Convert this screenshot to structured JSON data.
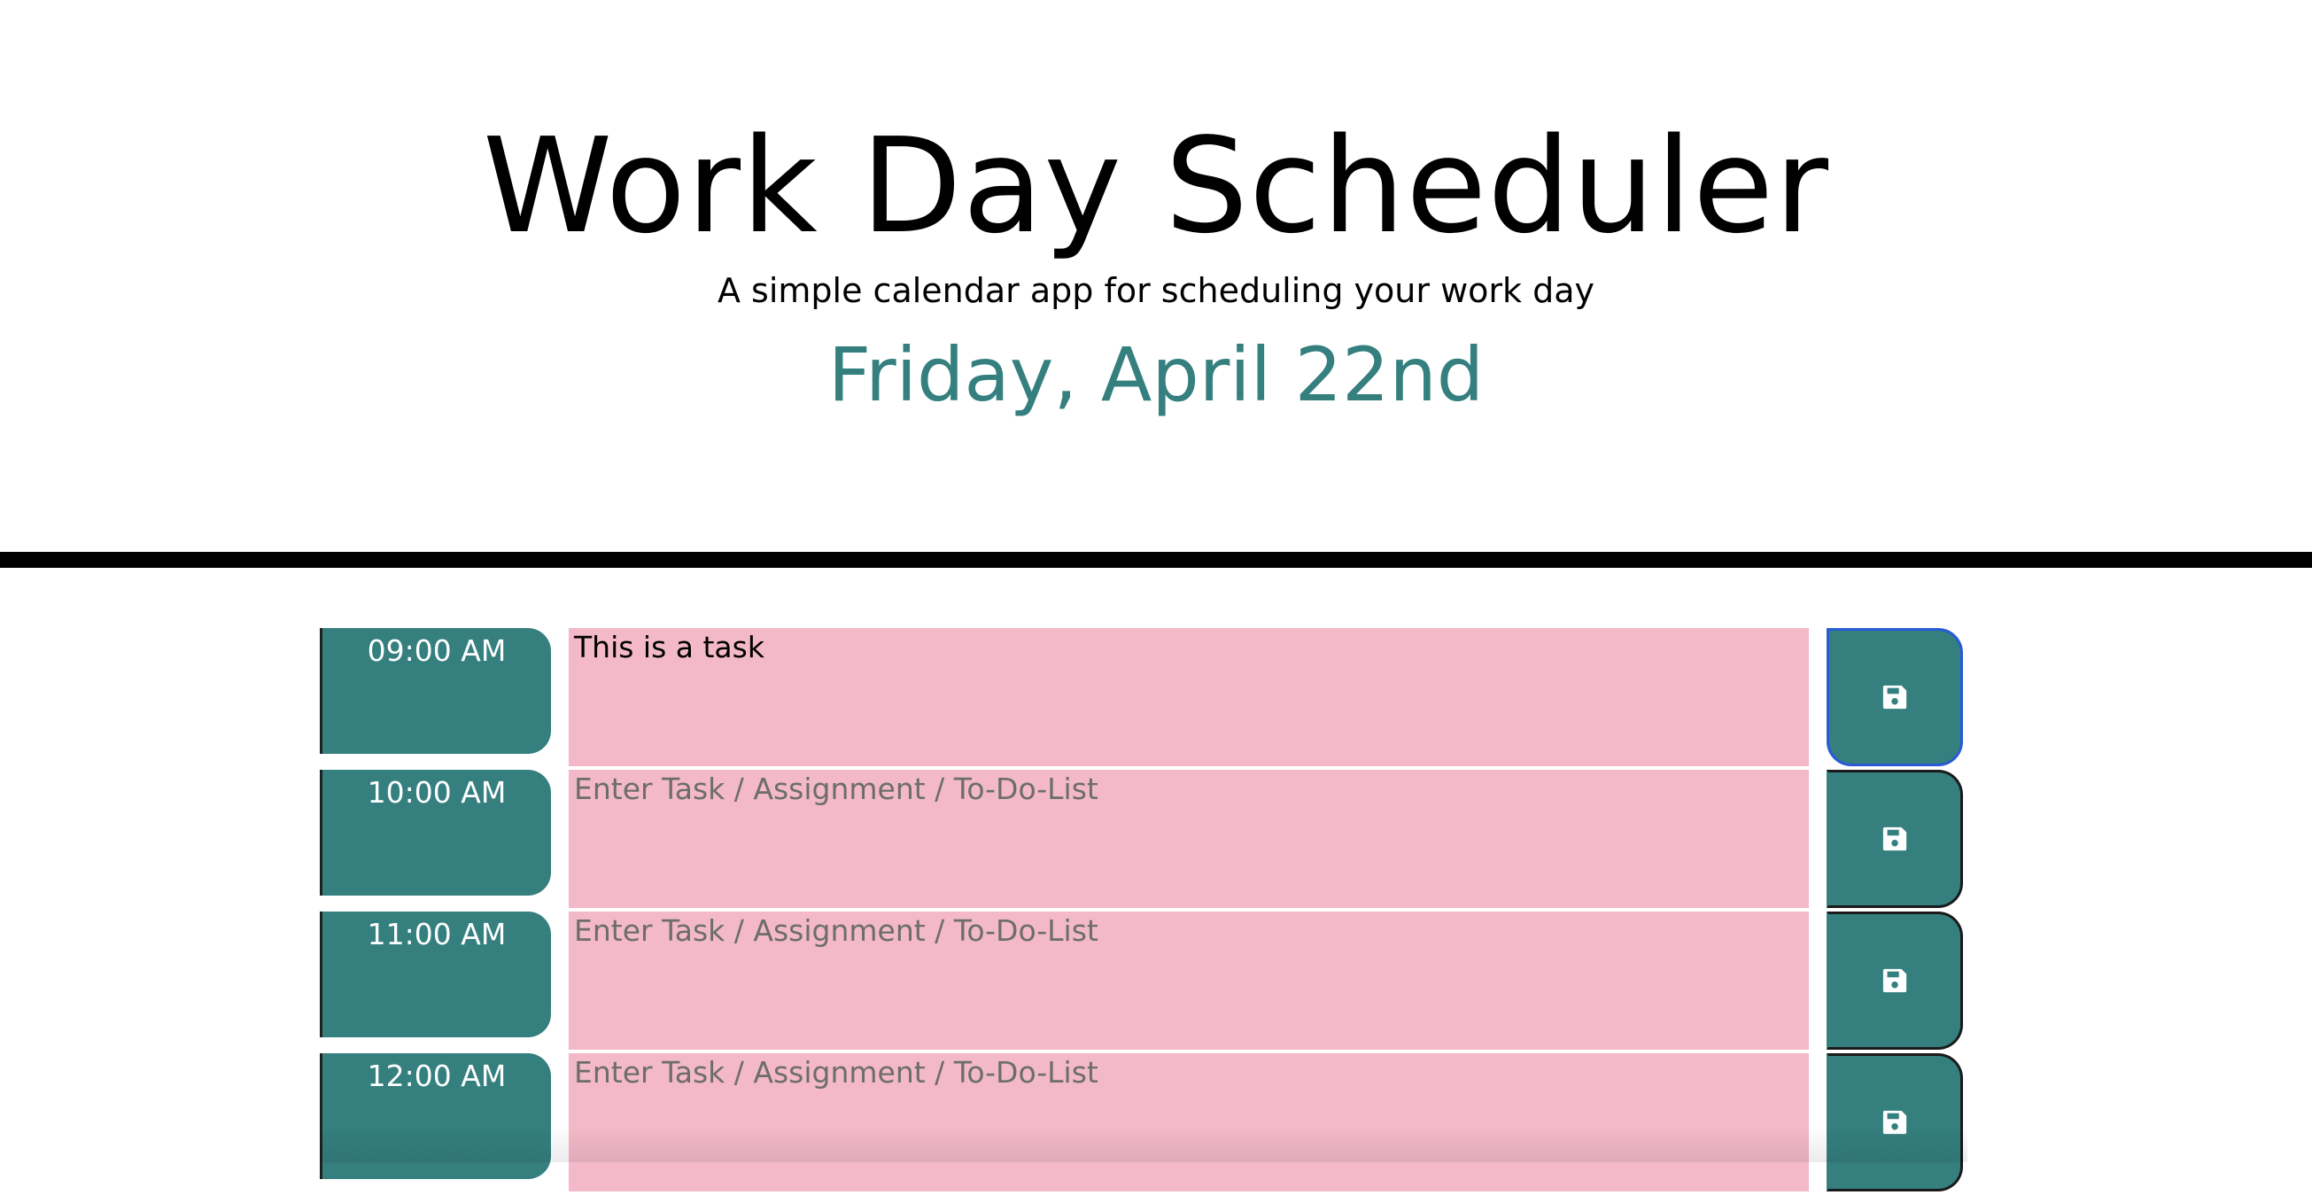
{
  "header": {
    "title": "Work Day Scheduler",
    "subtitle": "A simple calendar app for scheduling your work day",
    "current_day": "Friday, April 22nd"
  },
  "theme": {
    "accent": "#357f7f",
    "past_color": "#f3b9c9",
    "divider": "#000000",
    "focus_ring": "#2a5bd7"
  },
  "schedule": {
    "rows": [
      {
        "hour": "09:00 AM",
        "task": "This is a task",
        "placeholder": "Enter Task / Assignment / To-Do-List",
        "save_icon": "floppy-disk-icon"
      },
      {
        "hour": "10:00 AM",
        "task": "",
        "placeholder": "Enter Task / Assignment / To-Do-List",
        "save_icon": "floppy-disk-icon"
      },
      {
        "hour": "11:00 AM",
        "task": "",
        "placeholder": "Enter Task / Assignment / To-Do-List",
        "save_icon": "floppy-disk-icon"
      },
      {
        "hour": "12:00 AM",
        "task": "",
        "placeholder": "Enter Task / Assignment / To-Do-List",
        "save_icon": "floppy-disk-icon"
      }
    ]
  }
}
